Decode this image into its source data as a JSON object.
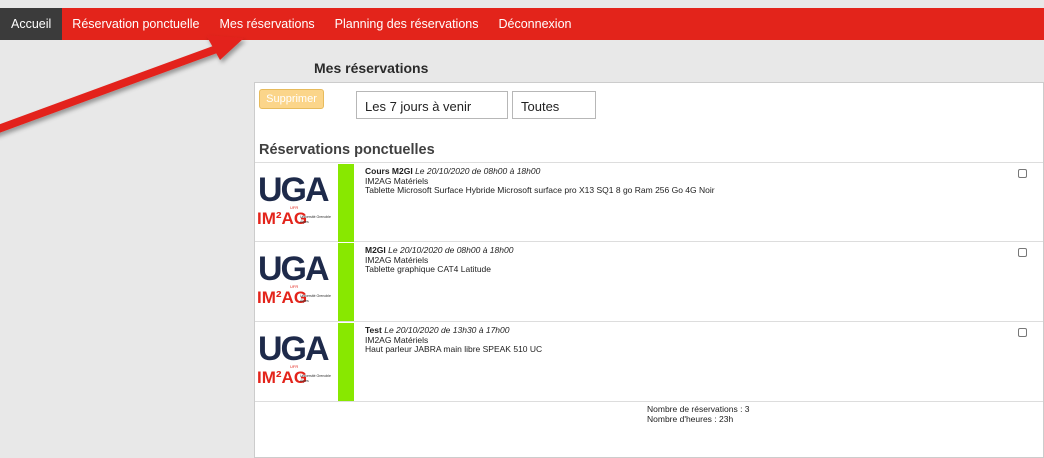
{
  "nav": {
    "items": [
      {
        "label": "Accueil",
        "active": true
      },
      {
        "label": "Réservation ponctuelle"
      },
      {
        "label": "Mes réservations"
      },
      {
        "label": "Planning des réservations"
      },
      {
        "label": "Déconnexion"
      }
    ],
    "bar_color": "#e3241b",
    "active_color": "#3b3b3b"
  },
  "page_title": "Mes réservations",
  "toolbar": {
    "delete_label": "Supprimer",
    "period_value": "Les 7 jours à venir",
    "type_value": "Toutes"
  },
  "section_title": "Réservations ponctuelles",
  "reservations": [
    {
      "name": "Cours M2GI",
      "date": "Le 20/10/2020 de 08h00 à 18h00",
      "owner": "IM2AG Matériels",
      "item": "Tablette Microsoft Surface Hybride Microsoft surface pro X13 SQ1 8 go Ram 256 Go 4G Noir"
    },
    {
      "name": "M2GI",
      "date": "Le 20/10/2020 de 08h00 à 18h00",
      "owner": "IM2AG Matériels",
      "item": "Tablette graphique CAT4 Latitude"
    },
    {
      "name": "Test",
      "date": "Le 20/10/2020 de 13h30 à 17h00",
      "owner": "IM2AG Matériels",
      "item": "Haut parleur JABRA main libre SPEAK 510 UC"
    }
  ],
  "logo": {
    "uga": "UGA",
    "ufr": "UFR",
    "im2ag": "IM²AG",
    "univ": "Université Grenoble Alpes"
  },
  "summary": {
    "count_line": "Nombre de réservations : 3",
    "hours_line": "Nombre d'heures : 23h"
  },
  "colors": {
    "status_green": "#88e800",
    "annotation_arrow": "#e3241b"
  }
}
